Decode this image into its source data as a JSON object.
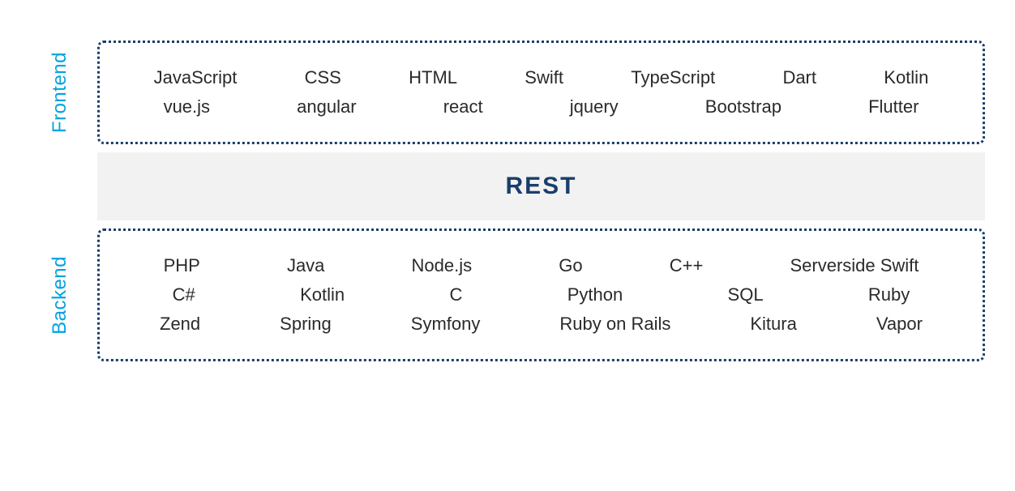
{
  "frontend": {
    "label": "Frontend",
    "row1": [
      "JavaScript",
      "CSS",
      "HTML",
      "Swift",
      "TypeScript",
      "Dart",
      "Kotlin"
    ],
    "row2": [
      "vue.js",
      "angular",
      "react",
      "jquery",
      "Bootstrap",
      "Flutter"
    ]
  },
  "rest": {
    "label": "REST"
  },
  "backend": {
    "label": "Backend",
    "row1": [
      "PHP",
      "Java",
      "Node.js",
      "Go",
      "C++",
      "Serverside Swift"
    ],
    "row2": [
      "C#",
      "Kotlin",
      "C",
      "Python",
      "SQL",
      "Ruby"
    ],
    "row3": [
      "Zend",
      "Spring",
      "Symfony",
      "Ruby on Rails",
      "Kitura",
      "Vapor"
    ]
  }
}
